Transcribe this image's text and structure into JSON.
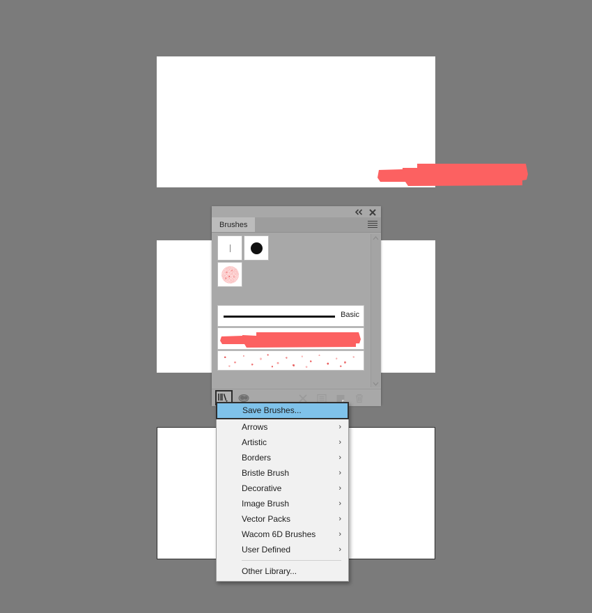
{
  "app": {
    "background_color": "#7b7b7b",
    "accent_highlight": "#7fc2ea",
    "stroke_color": "#fc6161"
  },
  "canvas": {
    "top_artboard_name": "artboard-top",
    "middle_artboard_name": "artboard-middle",
    "bottom_artboard_name": "artboard-bottom"
  },
  "panel": {
    "title": "Brushes",
    "tab_label": "Brushes",
    "collapse_icon": "collapse-double-chevron-icon",
    "close_icon": "close-icon",
    "menu_icon": "panel-menu-icon",
    "brush_definitions": [
      {
        "name": "calligraphic-thin-brush",
        "type": "line"
      },
      {
        "name": "calligraphic-round-brush",
        "type": "dot"
      },
      {
        "name": "scatter-speckle-brush",
        "type": "speckle-circle"
      }
    ],
    "brush_strokes": [
      {
        "name": "basic-stroke",
        "label": "Basic",
        "type": "line"
      },
      {
        "name": "marker-stroke",
        "label": "",
        "type": "marker"
      },
      {
        "name": "scatter-stroke",
        "label": "",
        "type": "scatter"
      }
    ],
    "footer_tools": [
      {
        "name": "brush-libraries-menu",
        "icon": "library-icon",
        "state": "pressed"
      },
      {
        "name": "brush-options",
        "icon": "brush-options-icon",
        "state": "enabled"
      },
      {
        "name": "remove-brush-stroke",
        "icon": "remove-stroke-icon",
        "state": "disabled"
      },
      {
        "name": "brush-options-dialog",
        "icon": "options-list-icon",
        "state": "disabled"
      },
      {
        "name": "new-brush",
        "icon": "new-brush-icon",
        "state": "disabled"
      },
      {
        "name": "delete-brush",
        "icon": "trash-icon",
        "state": "disabled"
      }
    ],
    "scroll_up_icon": "chevron-up-icon",
    "scroll_down_icon": "chevron-down-icon"
  },
  "menu": {
    "items": [
      {
        "label": "Save Brushes...",
        "has_submenu": false,
        "highlighted": true
      },
      {
        "label": "Arrows",
        "has_submenu": true,
        "highlighted": false
      },
      {
        "label": "Artistic",
        "has_submenu": true,
        "highlighted": false
      },
      {
        "label": "Borders",
        "has_submenu": true,
        "highlighted": false
      },
      {
        "label": "Bristle Brush",
        "has_submenu": true,
        "highlighted": false
      },
      {
        "label": "Decorative",
        "has_submenu": true,
        "highlighted": false
      },
      {
        "label": "Image Brush",
        "has_submenu": true,
        "highlighted": false
      },
      {
        "label": "Vector Packs",
        "has_submenu": true,
        "highlighted": false
      },
      {
        "label": "Wacom 6D Brushes",
        "has_submenu": true,
        "highlighted": false
      },
      {
        "label": "User Defined",
        "has_submenu": true,
        "highlighted": false
      }
    ],
    "footer_item": {
      "label": "Other Library...",
      "has_submenu": false
    },
    "submenu_arrow_glyph": "›"
  }
}
